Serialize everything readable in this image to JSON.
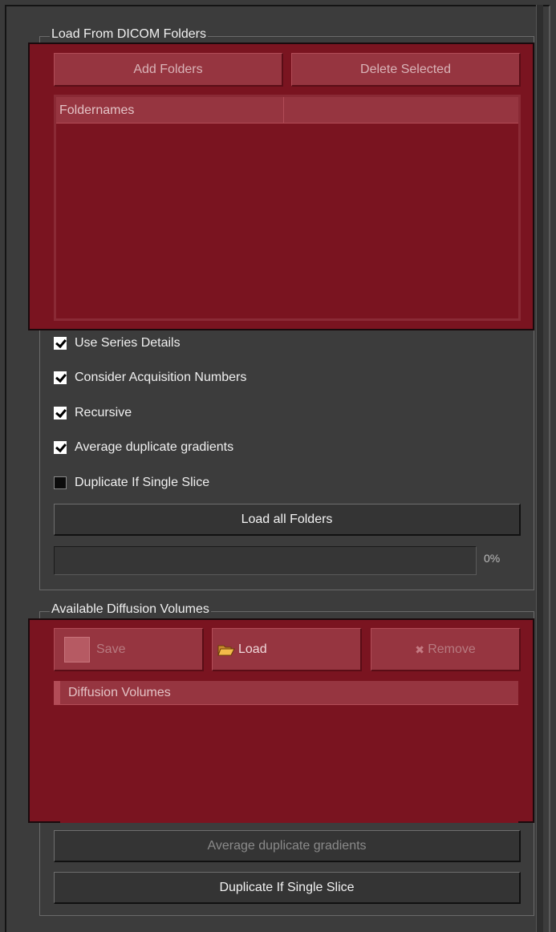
{
  "dicom_group": {
    "title": "Load From DICOM Folders",
    "add_folders_label": "Add Folders",
    "delete_selected_label": "Delete Selected",
    "table_columns": [
      "Foldernames",
      ""
    ],
    "options": [
      {
        "label": "Use Series Details",
        "checked": true
      },
      {
        "label": "Consider Acquisition Numbers",
        "checked": true
      },
      {
        "label": "Recursive",
        "checked": true
      },
      {
        "label": "Average duplicate gradients",
        "checked": true
      },
      {
        "label": "Duplicate If Single Slice",
        "checked": false
      }
    ],
    "load_all_label": "Load all Folders",
    "progress_percent": 0,
    "progress_text": "0%"
  },
  "volumes_group": {
    "title": "Available Diffusion Volumes",
    "save_label": "Save",
    "load_label": "Load",
    "remove_label": "Remove",
    "list_header": "Diffusion Volumes",
    "average_label": "Average duplicate gradients",
    "duplicate_label": "Duplicate If Single Slice"
  },
  "colors": {
    "overlay": "#7a1420",
    "overlay_button": "#963540",
    "panel": "#3c3c3c"
  },
  "icons": {
    "save": "save-icon",
    "load": "folder-open-icon",
    "remove": "remove-icon"
  }
}
